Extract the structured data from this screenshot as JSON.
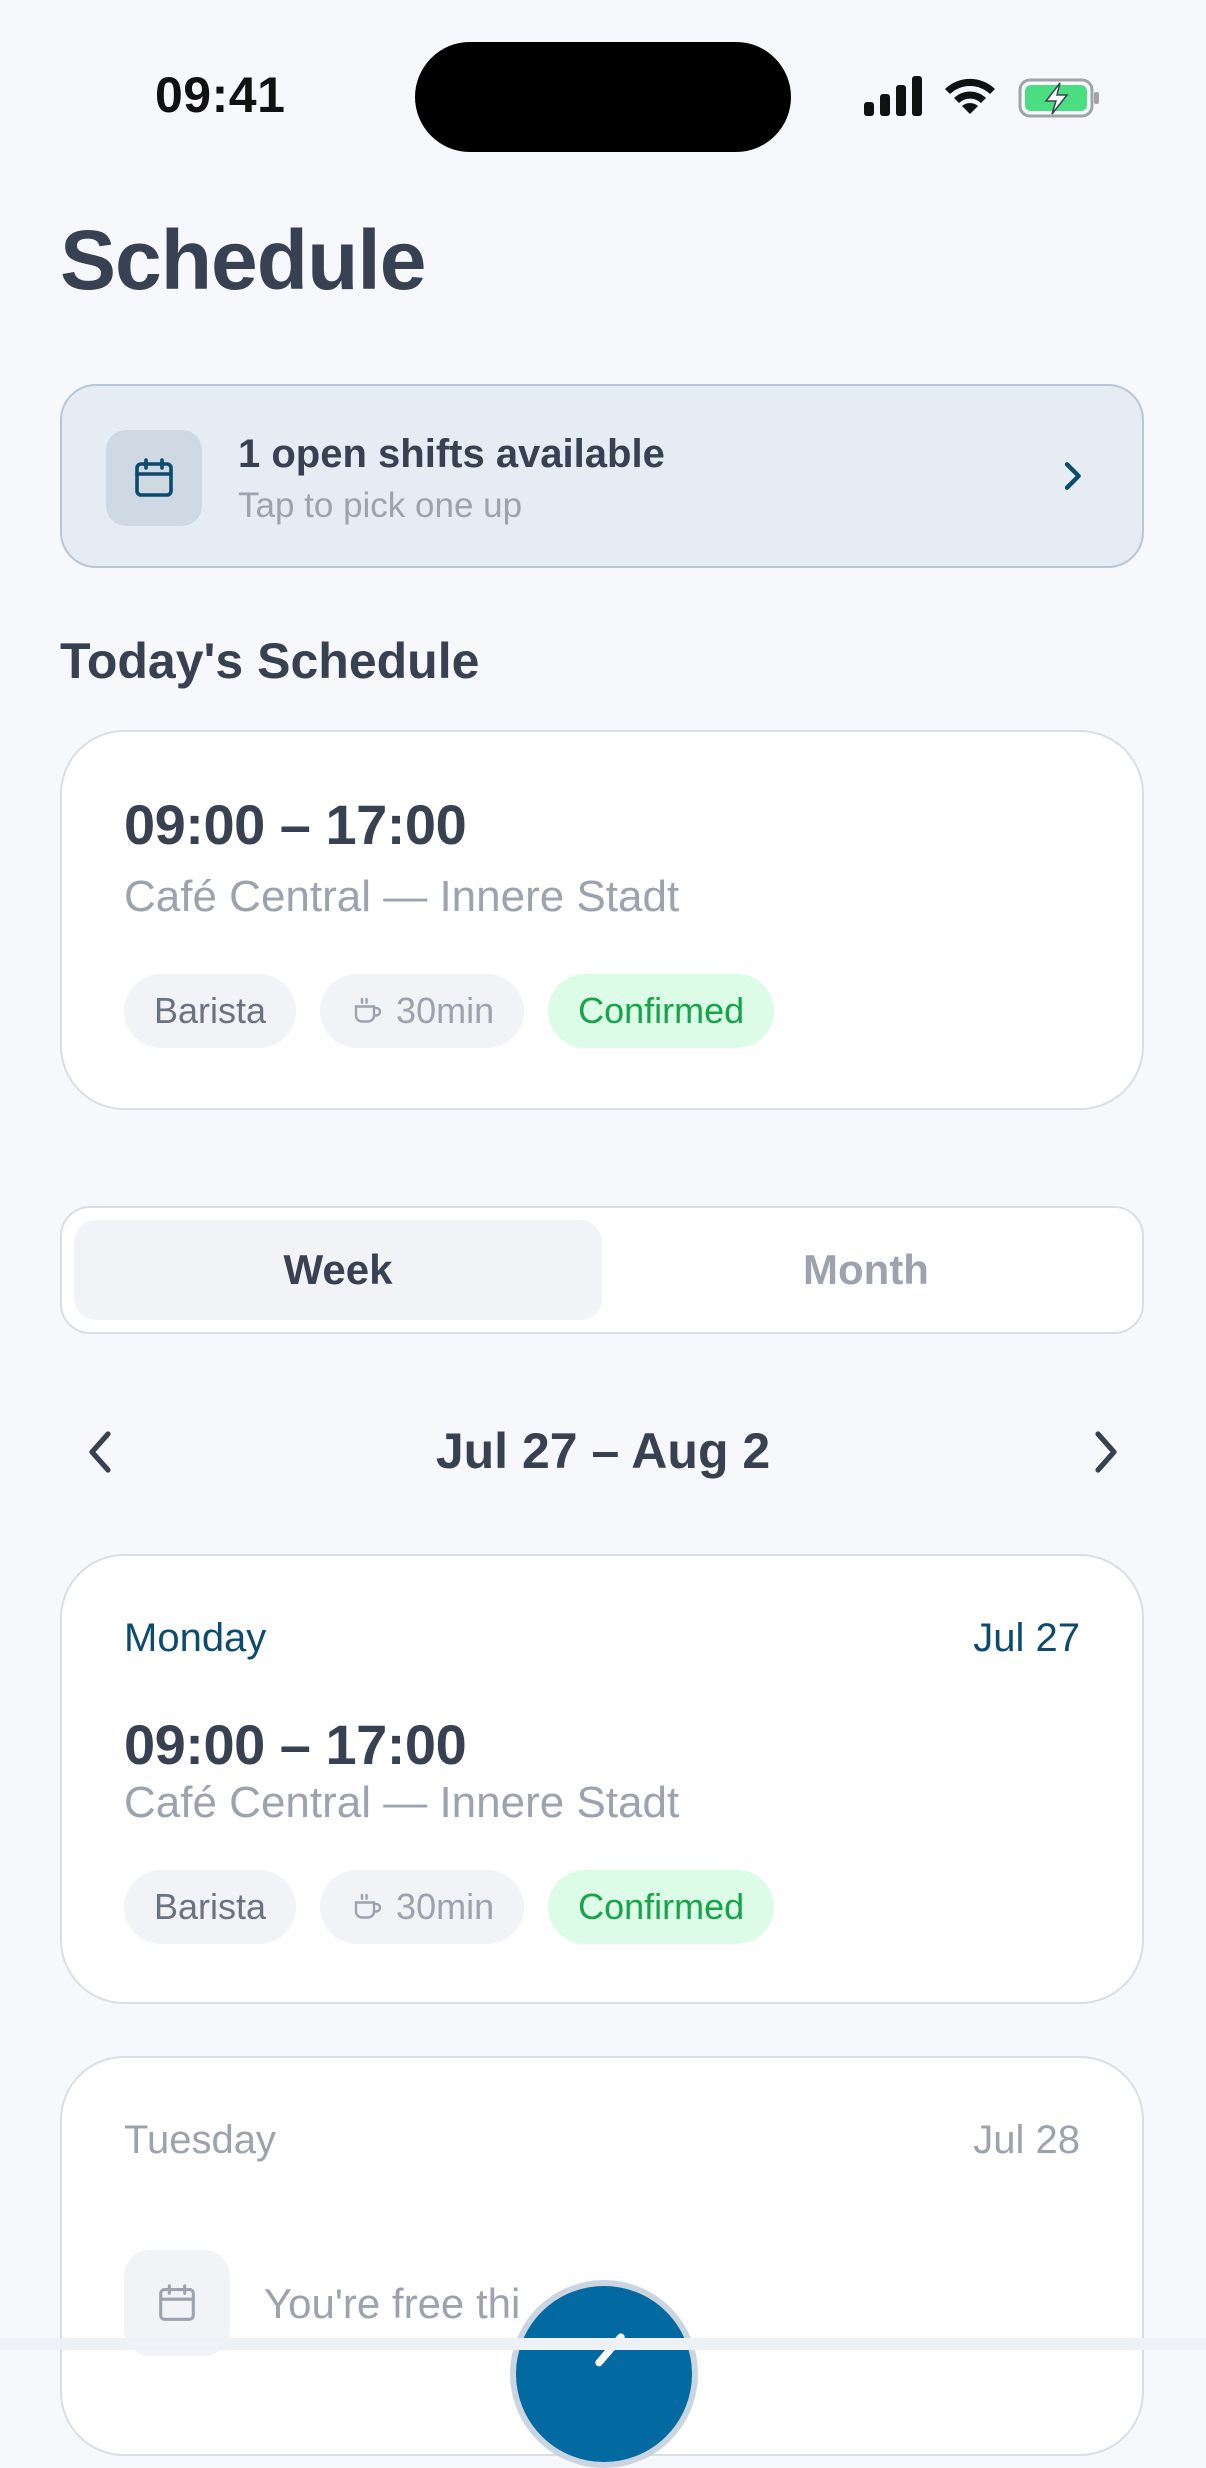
{
  "status_bar": {
    "time": "09:41"
  },
  "page": {
    "title": "Schedule"
  },
  "open_shifts_banner": {
    "title": "1 open shifts available",
    "subtitle": "Tap to pick one up"
  },
  "today": {
    "section_title": "Today's Schedule",
    "shift": {
      "time": "09:00 – 17:00",
      "location": "Café Central — Innere Stadt",
      "role": "Barista",
      "break": "30min",
      "status": "Confirmed"
    }
  },
  "view_toggle": {
    "week_label": "Week",
    "month_label": "Month",
    "selected": "Week"
  },
  "week_nav": {
    "range": "Jul 27 – Aug 2"
  },
  "days": [
    {
      "day": "Monday",
      "date": "Jul 27",
      "shift": {
        "time": "09:00 – 17:00",
        "location": "Café Central — Innere Stadt",
        "role": "Barista",
        "break": "30min",
        "status": "Confirmed"
      }
    },
    {
      "day": "Tuesday",
      "date": "Jul 28",
      "free_text": "You're free thi"
    }
  ],
  "colors": {
    "accent": "#0c4a6e",
    "confirmed_bg": "#dcfce7",
    "confirmed_text": "#16a34a",
    "fab": "#0369a1"
  },
  "icons": {
    "banner": "calendar-icon",
    "break": "coffee-cup-icon",
    "free_day": "calendar-icon",
    "fab": "pencil-icon"
  }
}
